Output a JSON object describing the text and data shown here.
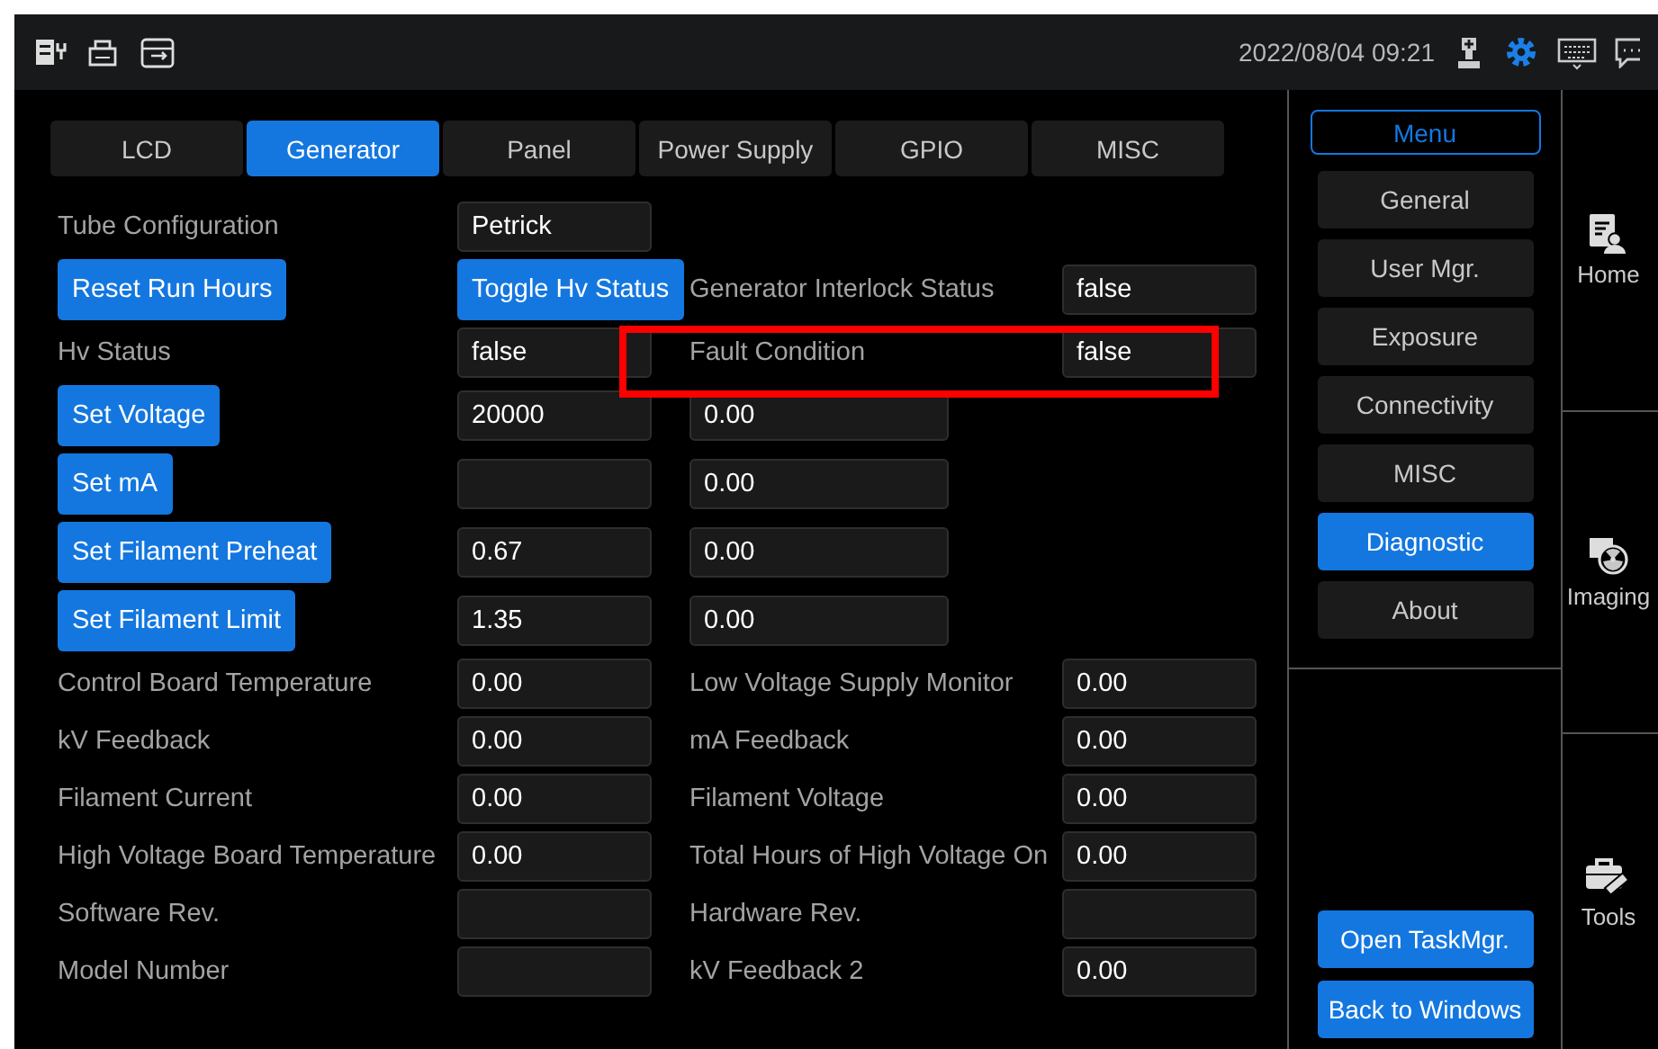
{
  "status_bar": {
    "datetime": "2022/08/04 09:21"
  },
  "tabs": [
    {
      "label": "LCD",
      "selected": false
    },
    {
      "label": "Generator",
      "selected": true
    },
    {
      "label": "Panel",
      "selected": false
    },
    {
      "label": "Power Supply",
      "selected": false
    },
    {
      "label": "GPIO",
      "selected": false
    },
    {
      "label": "MISC",
      "selected": false
    }
  ],
  "form_rows": [
    {
      "cells": [
        {
          "kind": "label",
          "text": "Tube Configuration"
        },
        {
          "kind": "field",
          "value": "Petrick"
        }
      ]
    },
    {
      "cells": [
        {
          "kind": "button",
          "text": "Reset Run Hours"
        },
        {
          "kind": "button",
          "text": "Toggle Hv Status"
        },
        {
          "kind": "label",
          "text": "Generator Interlock Status"
        },
        {
          "kind": "field",
          "value": "false"
        }
      ]
    },
    {
      "cells": [
        {
          "kind": "label",
          "text": "Hv Status"
        },
        {
          "kind": "field",
          "value": "false"
        },
        {
          "kind": "label",
          "text": "Fault Condition"
        },
        {
          "kind": "field",
          "value": "false"
        }
      ]
    },
    {
      "cells": [
        {
          "kind": "button",
          "text": "Set Voltage"
        },
        {
          "kind": "field",
          "value": "20000"
        },
        {
          "kind": "widefield",
          "value": "0.00"
        }
      ]
    },
    {
      "cells": [
        {
          "kind": "button",
          "text": "Set mA"
        },
        {
          "kind": "field"
        },
        {
          "kind": "widefield",
          "value": "0.00"
        }
      ]
    },
    {
      "cells": [
        {
          "kind": "button",
          "text": "Set Filament Preheat"
        },
        {
          "kind": "field",
          "value": "0.67"
        },
        {
          "kind": "widefield",
          "value": "0.00"
        }
      ]
    },
    {
      "cells": [
        {
          "kind": "button",
          "text": "Set Filament Limit"
        },
        {
          "kind": "field",
          "value": "1.35"
        },
        {
          "kind": "widefield",
          "value": "0.00"
        }
      ]
    },
    {
      "cells": [
        {
          "kind": "label",
          "text": "Control Board Temperature"
        },
        {
          "kind": "field",
          "value": "0.00"
        },
        {
          "kind": "label",
          "text": "Low Voltage Supply Monitor"
        },
        {
          "kind": "field",
          "value": "0.00"
        }
      ]
    },
    {
      "cells": [
        {
          "kind": "label",
          "text": "kV Feedback"
        },
        {
          "kind": "field",
          "value": "0.00"
        },
        {
          "kind": "label",
          "text": "mA Feedback"
        },
        {
          "kind": "field",
          "value": "0.00"
        }
      ]
    },
    {
      "cells": [
        {
          "kind": "label",
          "text": "Filament Current"
        },
        {
          "kind": "field",
          "value": "0.00"
        },
        {
          "kind": "label",
          "text": "Filament Voltage"
        },
        {
          "kind": "field",
          "value": "0.00"
        }
      ]
    },
    {
      "cells": [
        {
          "kind": "label",
          "text": "High Voltage Board Temperature"
        },
        {
          "kind": "field",
          "value": "0.00"
        },
        {
          "kind": "label",
          "text": "Total Hours of High Voltage On"
        },
        {
          "kind": "field",
          "value": "0.00"
        }
      ]
    },
    {
      "cells": [
        {
          "kind": "label",
          "text": "Software Rev."
        },
        {
          "kind": "field"
        },
        {
          "kind": "label",
          "text": "Hardware Rev."
        },
        {
          "kind": "field"
        }
      ]
    },
    {
      "cells": [
        {
          "kind": "label",
          "text": "Model Number"
        },
        {
          "kind": "field"
        },
        {
          "kind": "label",
          "text": "kV Feedback 2"
        },
        {
          "kind": "field",
          "value": "0.00"
        }
      ]
    }
  ],
  "annotations": [
    {
      "kind": "frame",
      "color": "#ff0000"
    }
  ],
  "menu": {
    "title": "Menu",
    "items": [
      {
        "label": "General",
        "selected": false
      },
      {
        "label": "User Mgr.",
        "selected": false
      },
      {
        "label": "Exposure",
        "selected": false
      },
      {
        "label": "Connectivity",
        "selected": false
      },
      {
        "label": "MISC",
        "selected": false
      },
      {
        "label": "Diagnostic",
        "selected": true
      },
      {
        "label": "About",
        "selected": false
      }
    ],
    "actions": [
      "Open TaskMgr.",
      "Back to Windows"
    ]
  },
  "nav": [
    {
      "label": "Home"
    },
    {
      "label": "Imaging"
    },
    {
      "label": "Tools"
    }
  ]
}
